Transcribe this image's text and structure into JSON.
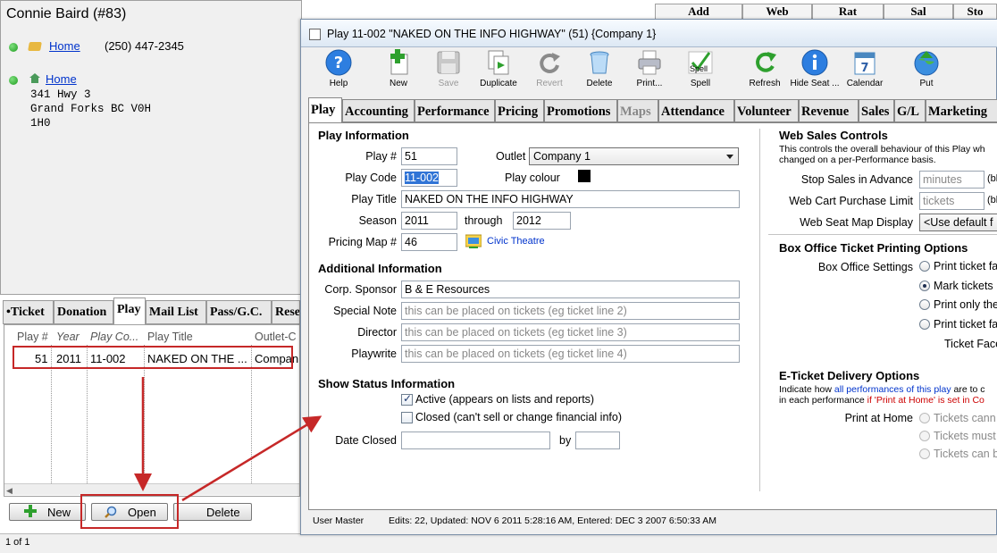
{
  "patron": {
    "name": "Connie Baird (#83)",
    "phone_label": "Home",
    "phone": "(250) 447-2345",
    "address_label": "Home",
    "address_lines": [
      "341 Hwy 3",
      "Grand Forks BC  V0H",
      "1H0"
    ]
  },
  "top_tabs": [
    "Add",
    "Web",
    "Rat",
    "Sal",
    "Sto"
  ],
  "bottom_tabs": [
    "•Ticket",
    "Donation",
    "Play",
    "Mail List",
    "Pass/G.C.",
    "Rese"
  ],
  "play_list": {
    "headers": [
      "Play #",
      "Year",
      "Play Co...",
      "Play Title",
      "Outlet-C"
    ],
    "rows": [
      {
        "play_no": "51",
        "year": "2011",
        "code": "11-002",
        "title": "NAKED ON THE ...",
        "outlet": "Compan"
      }
    ]
  },
  "buttons": {
    "new": "New",
    "open": "Open",
    "delete": "Delete"
  },
  "status_bar": "1 of 1",
  "dialog": {
    "title": "Play 11-002 \"NAKED ON THE INFO HIGHWAY\" (51) {Company 1}",
    "toolbar": [
      "Help",
      "New",
      "Save",
      "Duplicate",
      "Revert",
      "Delete",
      "Print...",
      "Spell",
      "Refresh",
      "Hide Seat ...",
      "Calendar",
      "Put"
    ],
    "spell_icon_text": "Spell",
    "tabs": [
      "Play",
      "Accounting",
      "Performance",
      "Pricing",
      "Promotions",
      "Maps",
      "Attendance",
      "Volunteer",
      "Revenue",
      "Sales",
      "G/L",
      "Marketing"
    ],
    "play_info": {
      "heading": "Play Information",
      "play_no_label": "Play #",
      "play_no": "51",
      "outlet_label": "Outlet",
      "outlet": "Company 1",
      "code_label": "Play Code",
      "code": "11-002",
      "colour_label": "Play colour",
      "title_label": "Play Title",
      "title": "NAKED ON THE INFO HIGHWAY",
      "season_label": "Season",
      "season_from": "2011",
      "through_label": "through",
      "season_to": "2012",
      "map_label": "Pricing Map #",
      "map_no": "46",
      "map_name": "Civic Theatre"
    },
    "additional": {
      "heading": "Additional Information",
      "sponsor_label": "Corp. Sponsor",
      "sponsor": "B & E Resources",
      "note_label": "Special Note",
      "note_placeholder": "this can be placed on tickets (eg ticket line 2)",
      "director_label": "Director",
      "director_placeholder": "this can be placed on tickets (eg ticket line 3)",
      "playwrite_label": "Playwrite",
      "playwrite_placeholder": "this can be placed on tickets (eg ticket line 4)"
    },
    "status": {
      "heading": "Show Status Information",
      "active_label": "Active (appears on lists and reports)",
      "closed_label": "Closed (can't sell or change financial info)",
      "date_closed_label": "Date Closed",
      "by_label": "by"
    },
    "web_sales": {
      "heading": "Web Sales Controls",
      "desc1": "This controls the overall behaviour of this Play wh",
      "desc2": "changed on a per-Performance basis.",
      "stop_label": "Stop Sales in Advance",
      "stop_placeholder": "minutes",
      "stop_unit": "(bl",
      "limit_label": "Web Cart Purchase Limit",
      "limit_placeholder": "tickets",
      "limit_unit": "(bl",
      "seatmap_label": "Web Seat Map Display",
      "seatmap_value": "<Use default f"
    },
    "box_office": {
      "heading": "Box Office Ticket Printing Options",
      "settings_label": "Box Office Settings",
      "options": [
        "Print ticket fa",
        "Mark tickets",
        "Print only the",
        "Print ticket fa"
      ],
      "ticket_face_label": "Ticket Face"
    },
    "eticket": {
      "heading": "E-Ticket Delivery Options",
      "desc1a": "Indicate how ",
      "desc1b": "all performances of this play",
      "desc1c": " are to c",
      "desc2a": "in each performance ",
      "desc2b": "if 'Print at Home' is set in Co",
      "print_home_label": "Print at Home",
      "options": [
        "Tickets cann",
        "Tickets must",
        "Tickets can b"
      ]
    },
    "footer": {
      "user": "User Master",
      "edits": "Edits: 22, Updated: NOV 6 2011 5:28:16 AM, Entered: DEC 3 2007 6:50:33 AM"
    }
  }
}
